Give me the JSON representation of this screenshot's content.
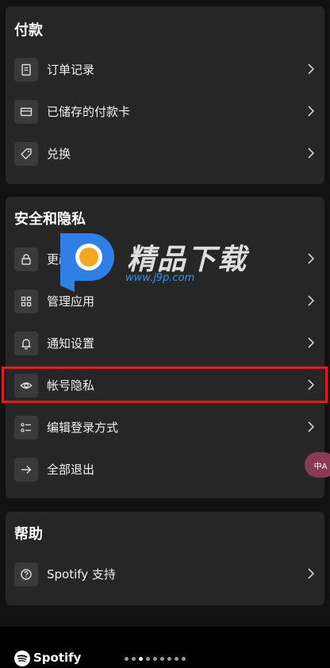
{
  "sections": {
    "payment": {
      "title": "付款",
      "items": [
        {
          "label": "订单记录",
          "icon": "receipt-icon"
        },
        {
          "label": "已储存的付款卡",
          "icon": "credit-card-icon"
        },
        {
          "label": "兑换",
          "icon": "tag-icon"
        }
      ]
    },
    "security": {
      "title": "安全和隐私",
      "items": [
        {
          "label": "更改密码",
          "icon": "lock-icon"
        },
        {
          "label": "管理应用",
          "icon": "apps-grid-icon"
        },
        {
          "label": "通知设置",
          "icon": "bell-icon"
        },
        {
          "label": "帐号隐私",
          "icon": "eye-icon"
        },
        {
          "label": "编辑登录方式",
          "icon": "list-icon"
        },
        {
          "label": "全部退出",
          "icon": "arrow-right-icon"
        }
      ]
    },
    "help": {
      "title": "帮助",
      "items": [
        {
          "label": "Spotify 支持",
          "icon": "question-icon"
        }
      ]
    }
  },
  "footer": {
    "brand": "Spotify",
    "page_count": 9,
    "active_page": 3
  },
  "watermark": {
    "text": "精品下载",
    "url": "www.j9p.com"
  },
  "translate_button": {
    "label": "中A"
  },
  "colors": {
    "background": "#121212",
    "card": "#262626",
    "highlight": "#e02020",
    "watermark_blue": "#2f7fe6",
    "watermark_orange": "#f5a623"
  }
}
